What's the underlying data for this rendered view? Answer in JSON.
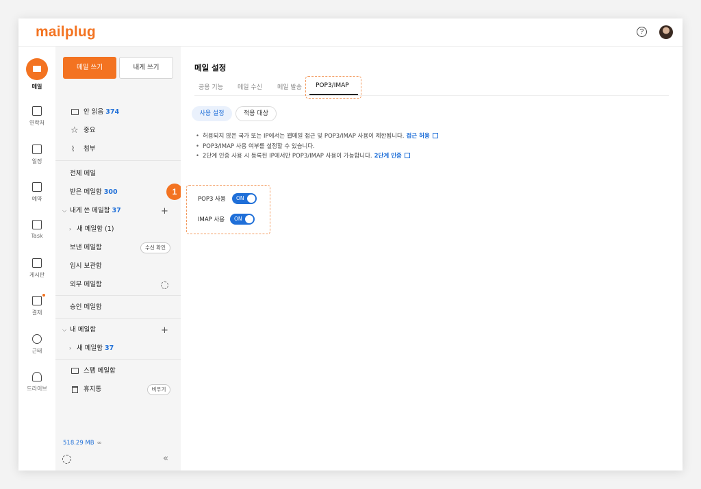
{
  "app": {
    "logo": "mailplug"
  },
  "header": {
    "help_icon": "help-circle-icon",
    "avatar_icon": "user-avatar"
  },
  "rail": {
    "items": [
      {
        "label": "메일",
        "icon": "mail-icon"
      },
      {
        "label": "연락처",
        "icon": "contacts-icon"
      },
      {
        "label": "일정",
        "icon": "calendar-icon"
      },
      {
        "label": "예약",
        "icon": "reservation-icon"
      },
      {
        "label": "Task",
        "icon": "task-icon"
      },
      {
        "label": "게시판",
        "icon": "board-icon"
      },
      {
        "label": "결재",
        "icon": "approval-icon"
      },
      {
        "label": "근태",
        "icon": "clock-icon"
      },
      {
        "label": "드라이브",
        "icon": "cloud-icon"
      }
    ]
  },
  "panel": {
    "compose_label": "메일 쓰기",
    "self_label": "내게 쓰기",
    "unread": {
      "label": "안 읽음",
      "count": "374"
    },
    "important": "중요",
    "attachment": "첨부",
    "all_mail": "전체 메일",
    "inbox": {
      "label": "받은 메일함",
      "count": "300"
    },
    "self_box": {
      "label": "내게 쓴 메일함",
      "count": "37"
    },
    "self_sub": {
      "label": "새 메일함 (1)"
    },
    "sent": "보낸 메일함",
    "sent_pill": "수신 확인",
    "drafts": "임시 보관함",
    "external": "외부 메일함",
    "approval": "승인 메일함",
    "my_box": "내 메일함",
    "my_sub": {
      "label": "새 메일함",
      "count": "37"
    },
    "spam": "스팸 메일함",
    "trash": "휴지통",
    "trash_pill": "비우기",
    "storage": "518.29 MB",
    "storage_unit": "∞",
    "collapse_glyph": "«",
    "plus_glyph": "+"
  },
  "badge": "1",
  "main": {
    "title": "메일 설정",
    "tabs": [
      "공용 기능",
      "메일 수신",
      "메일 발송",
      "POP3/IMAP"
    ],
    "segments": [
      "사용 설정",
      "적용 대상"
    ],
    "notes": [
      {
        "text": "허용되지 않은 국가 또는 IP에서는 웹메일 접근 및 POP3/IMAP 사용이 제한됩니다.",
        "link": "접근 허용"
      },
      {
        "text": "POP3/IMAP 사용 여부를 설정할 수 있습니다.",
        "link": ""
      },
      {
        "text": "2단계 인증 사용 시 등록된 IP에서만 POP3/IMAP 사용이 가능합니다.",
        "link": "2단계 인증"
      }
    ],
    "bullet": "•",
    "options": [
      {
        "label": "POP3 사용",
        "state": "ON"
      },
      {
        "label": "IMAP 사용",
        "state": "ON"
      }
    ]
  },
  "colors": {
    "accent": "#f37321",
    "link": "#1f6fd8"
  }
}
